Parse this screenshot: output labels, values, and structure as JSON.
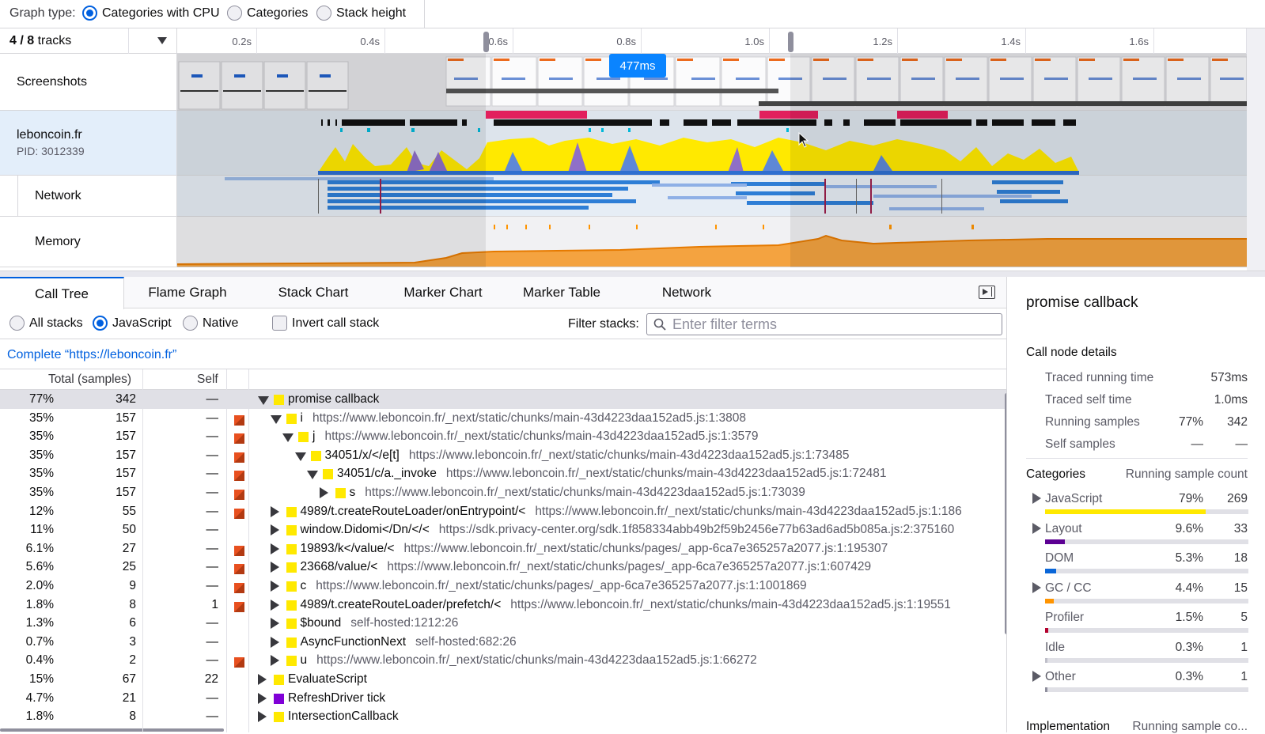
{
  "top_bar": {
    "graph_type_label": "Graph type:",
    "options": [
      "Categories with CPU",
      "Categories",
      "Stack height"
    ],
    "selected": "Categories with CPU"
  },
  "timeline": {
    "tracks_count": "4 / 8",
    "tracks_label": "tracks",
    "ticks": [
      "0.2s",
      "0.4s",
      "0.6s",
      "0.8s",
      "1.0s",
      "1.2s",
      "1.4s",
      "1.6s"
    ],
    "selection_duration": "477ms",
    "tracks": {
      "screenshots": "Screenshots",
      "process_name": "leboncoin.fr",
      "process_pid": "PID: 3012339",
      "network": "Network",
      "memory": "Memory"
    }
  },
  "tabs": [
    "Call Tree",
    "Flame Graph",
    "Stack Chart",
    "Marker Chart",
    "Marker Table",
    "Network"
  ],
  "selected_tab": "Call Tree",
  "settings": {
    "stack_options": [
      "All stacks",
      "JavaScript",
      "Native"
    ],
    "selected_stack": "JavaScript",
    "invert_label": "Invert call stack",
    "filter_label": "Filter stacks:",
    "filter_placeholder": "Enter filter terms"
  },
  "breadcrumb": "Complete “https://leboncoin.fr”",
  "tree_header": {
    "total": "Total (samples)",
    "self": "Self"
  },
  "tree_rows": [
    {
      "pct": "77%",
      "total": "342",
      "self": "—",
      "depth": 0,
      "state": "open",
      "name": "promise callback",
      "url": "",
      "color": "#ffe900",
      "icon": false,
      "selected": true
    },
    {
      "pct": "35%",
      "total": "157",
      "self": "—",
      "depth": 1,
      "state": "open",
      "name": "i",
      "url": "https://www.leboncoin.fr/_next/static/chunks/main-43d4223daa152ad5.js:1:3808",
      "color": "#ffe900",
      "icon": true
    },
    {
      "pct": "35%",
      "total": "157",
      "self": "—",
      "depth": 2,
      "state": "open",
      "name": "j",
      "url": "https://www.leboncoin.fr/_next/static/chunks/main-43d4223daa152ad5.js:1:3579",
      "color": "#ffe900",
      "icon": true
    },
    {
      "pct": "35%",
      "total": "157",
      "self": "—",
      "depth": 3,
      "state": "open",
      "name": "34051/x/</e[t]",
      "url": "https://www.leboncoin.fr/_next/static/chunks/main-43d4223daa152ad5.js:1:73485",
      "color": "#ffe900",
      "icon": true
    },
    {
      "pct": "35%",
      "total": "157",
      "self": "—",
      "depth": 4,
      "state": "open",
      "name": "34051/c/a._invoke",
      "url": "https://www.leboncoin.fr/_next/static/chunks/main-43d4223daa152ad5.js:1:72481",
      "color": "#ffe900",
      "icon": true
    },
    {
      "pct": "35%",
      "total": "157",
      "self": "—",
      "depth": 5,
      "state": "closed",
      "name": "s",
      "url": "https://www.leboncoin.fr/_next/static/chunks/main-43d4223daa152ad5.js:1:73039",
      "color": "#ffe900",
      "icon": true
    },
    {
      "pct": "12%",
      "total": "55",
      "self": "—",
      "depth": 1,
      "state": "closed",
      "name": "4989/t.createRouteLoader/onEntrypoint/<",
      "url": "https://www.leboncoin.fr/_next/static/chunks/main-43d4223daa152ad5.js:1:186",
      "color": "#ffe900",
      "icon": true
    },
    {
      "pct": "11%",
      "total": "50",
      "self": "—",
      "depth": 1,
      "state": "closed",
      "name": "window.Didomi</Dn/</<",
      "url": "https://sdk.privacy-center.org/sdk.1f858334abb49b2f59b2456e77b63ad6ad5b085a.js:2:375160",
      "color": "#ffe900",
      "icon": false
    },
    {
      "pct": "6.1%",
      "total": "27",
      "self": "—",
      "depth": 1,
      "state": "closed",
      "name": "19893/k</value/<",
      "url": "https://www.leboncoin.fr/_next/static/chunks/pages/_app-6ca7e365257a2077.js:1:195307",
      "color": "#ffe900",
      "icon": true
    },
    {
      "pct": "5.6%",
      "total": "25",
      "self": "—",
      "depth": 1,
      "state": "closed",
      "name": "23668/value/<",
      "url": "https://www.leboncoin.fr/_next/static/chunks/pages/_app-6ca7e365257a2077.js:1:607429",
      "color": "#ffe900",
      "icon": true
    },
    {
      "pct": "2.0%",
      "total": "9",
      "self": "—",
      "depth": 1,
      "state": "closed",
      "name": "c",
      "url": "https://www.leboncoin.fr/_next/static/chunks/pages/_app-6ca7e365257a2077.js:1:1001869",
      "color": "#ffe900",
      "icon": true
    },
    {
      "pct": "1.8%",
      "total": "8",
      "self": "1",
      "depth": 1,
      "state": "closed",
      "name": "4989/t.createRouteLoader/prefetch/<",
      "url": "https://www.leboncoin.fr/_next/static/chunks/main-43d4223daa152ad5.js:1:19551",
      "color": "#ffe900",
      "icon": true
    },
    {
      "pct": "1.3%",
      "total": "6",
      "self": "—",
      "depth": 1,
      "state": "closed",
      "name": "$bound",
      "url": "self-hosted:1212:26",
      "color": "#ffe900",
      "icon": false
    },
    {
      "pct": "0.7%",
      "total": "3",
      "self": "—",
      "depth": 1,
      "state": "closed",
      "name": "AsyncFunctionNext",
      "url": "self-hosted:682:26",
      "color": "#ffe900",
      "icon": false
    },
    {
      "pct": "0.4%",
      "total": "2",
      "self": "—",
      "depth": 1,
      "state": "closed",
      "name": "u",
      "url": "https://www.leboncoin.fr/_next/static/chunks/main-43d4223daa152ad5.js:1:66272",
      "color": "#ffe900",
      "icon": true
    },
    {
      "pct": "15%",
      "total": "67",
      "self": "22",
      "depth": 0,
      "state": "closed",
      "name": "EvaluateScript",
      "url": "",
      "color": "#ffe900",
      "icon": false
    },
    {
      "pct": "4.7%",
      "total": "21",
      "self": "—",
      "depth": 0,
      "state": "closed",
      "name": "RefreshDriver tick",
      "url": "",
      "color": "#8000d7",
      "icon": false
    },
    {
      "pct": "1.8%",
      "total": "8",
      "self": "—",
      "depth": 0,
      "state": "closed",
      "name": "IntersectionCallback",
      "url": "",
      "color": "#ffe900",
      "icon": false
    }
  ],
  "sidebar": {
    "title": "promise callback",
    "details_heading": "Call node details",
    "details": [
      {
        "label": "Traced running time",
        "v1": "",
        "v2": "573ms"
      },
      {
        "label": "Traced self time",
        "v1": "",
        "v2": "1.0ms"
      },
      {
        "label": "Running samples",
        "v1": "77%",
        "v2": "342"
      },
      {
        "label": "Self samples",
        "v1": "—",
        "v2": "—"
      }
    ],
    "categories_heading": "Categories",
    "categories_col": "Running sample count",
    "categories": [
      {
        "name": "JavaScript",
        "pct": "79%",
        "count": "269",
        "fraction": 0.79,
        "color": "#ffe900",
        "expandable": true
      },
      {
        "name": "Layout",
        "pct": "9.6%",
        "count": "33",
        "fraction": 0.096,
        "color": "#5c0093",
        "expandable": true
      },
      {
        "name": "DOM",
        "pct": "5.3%",
        "count": "18",
        "fraction": 0.053,
        "color": "#0a66d8",
        "expandable": false
      },
      {
        "name": "GC / CC",
        "pct": "4.4%",
        "count": "15",
        "fraction": 0.044,
        "color": "#ff9400",
        "expandable": true
      },
      {
        "name": "Profiler",
        "pct": "1.5%",
        "count": "5",
        "fraction": 0.015,
        "color": "#b4002d",
        "expandable": false
      },
      {
        "name": "Idle",
        "pct": "0.3%",
        "count": "1",
        "fraction": 0.003,
        "color": "#bfbfc9",
        "expandable": false
      },
      {
        "name": "Other",
        "pct": "0.3%",
        "count": "1",
        "fraction": 0.003,
        "color": "#8f8f9d",
        "expandable": true
      }
    ],
    "implementation_heading": "Implementation",
    "implementation_col": "Running sample co..."
  }
}
